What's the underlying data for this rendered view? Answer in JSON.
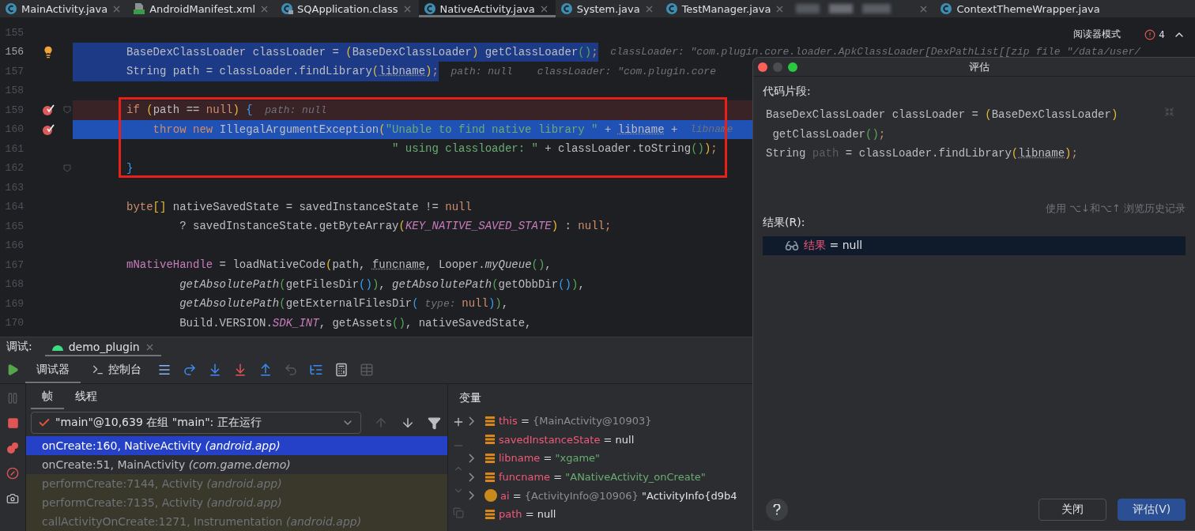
{
  "tabs": [
    {
      "label": "MainActivity.java",
      "kind": "class",
      "selected": false,
      "closable": true
    },
    {
      "label": "AndroidManifest.xml",
      "kind": "manifest",
      "selected": false,
      "closable": true
    },
    {
      "label": "SQApplication.class",
      "kind": "locked",
      "selected": false,
      "closable": true
    },
    {
      "label": "NativeActivity.java",
      "kind": "class",
      "selected": true,
      "closable": true
    },
    {
      "label": "System.java",
      "kind": "class",
      "selected": false,
      "closable": true
    },
    {
      "label": "TestManager.java",
      "kind": "class",
      "selected": false,
      "closable": true
    },
    {
      "kind": "blurred",
      "selected": false,
      "closable": true
    },
    {
      "label": "ContextThemeWrapper.java",
      "kind": "class",
      "selected": false,
      "closable": false
    }
  ],
  "reader_mode": "阅读器模式",
  "problems": {
    "count": "4"
  },
  "editor": {
    "lines": [
      {
        "number": "155"
      },
      {
        "number": "156",
        "intention": true,
        "selected": true,
        "tokens": [
          {
            "kind": "p",
            "text": "BaseDexClassLoader classLoader = "
          },
          {
            "kind": "y",
            "text": "("
          },
          {
            "kind": "p",
            "text": "BaseDexClassLoader"
          },
          {
            "kind": "y",
            "text": ")"
          },
          {
            "kind": "p",
            "text": " getClassLoader"
          },
          {
            "kind": "g",
            "text": "()"
          },
          {
            "kind": "k",
            "text": ";"
          },
          {
            "kind": "h",
            "text": "  classLoader: \"com.plugin.core.loader.ApkClassLoader[DexPathList[[zip file \"/data/user/"
          }
        ]
      },
      {
        "number": "157",
        "selected": true,
        "tokens": [
          {
            "kind": "p",
            "text": "String path = classLoader.findLibrary"
          },
          {
            "kind": "y",
            "text": "("
          },
          {
            "kind": "u",
            "text": "libname"
          },
          {
            "kind": "y",
            "text": ")"
          },
          {
            "kind": "k",
            "text": ";"
          },
          {
            "kind": "h",
            "text": "  path: null    classLoader: \"com.plugin.core"
          }
        ]
      },
      {
        "number": "158"
      },
      {
        "number": "159",
        "breakpoint": true,
        "fold": true,
        "boxed": true,
        "tokens": [
          {
            "kind": "k",
            "text": "if "
          },
          {
            "kind": "y",
            "text": "("
          },
          {
            "kind": "p",
            "text": "path == "
          },
          {
            "kind": "k",
            "text": "null"
          },
          {
            "kind": "y",
            "text": ")"
          },
          {
            "kind": "b",
            "text": " {"
          },
          {
            "kind": "h",
            "text": "  path: null"
          }
        ]
      },
      {
        "number": "160",
        "breakpoint": true,
        "current": true,
        "boxed": true,
        "tokens": [
          {
            "kind": "k",
            "text": "    throw new "
          },
          {
            "kind": "p",
            "text": "IllegalArgumentException"
          },
          {
            "kind": "y",
            "text": "("
          },
          {
            "kind": "s",
            "text": "\"Unable to find native library \""
          },
          {
            "kind": "p",
            "text": " + "
          },
          {
            "kind": "u",
            "text": "libname"
          },
          {
            "kind": "p",
            "text": " +"
          },
          {
            "kind": "h",
            "text": "  libname"
          }
        ]
      },
      {
        "number": "161",
        "boxed": true,
        "tokens": [
          {
            "kind": "s",
            "text": "                                        \" using classloader: \""
          },
          {
            "kind": "p",
            "text": " + classLoader.toString"
          },
          {
            "kind": "g",
            "text": "()"
          },
          {
            "kind": "y",
            "text": ")"
          },
          {
            "kind": "k",
            "text": ";"
          }
        ]
      },
      {
        "number": "162",
        "fold": true,
        "boxed": true,
        "tokens": [
          {
            "kind": "b",
            "text": "}"
          }
        ]
      },
      {
        "number": "163"
      },
      {
        "number": "164",
        "tokens": [
          {
            "kind": "k",
            "text": "byte"
          },
          {
            "kind": "y",
            "text": "[]"
          },
          {
            "kind": "p",
            "text": " nativeSavedState = savedInstanceState != "
          },
          {
            "kind": "k",
            "text": "null"
          }
        ]
      },
      {
        "number": "165",
        "tokens": [
          {
            "kind": "p",
            "text": "        ? savedInstanceState.getByteArray"
          },
          {
            "kind": "y",
            "text": "("
          },
          {
            "kind": "c",
            "text": "KEY_NATIVE_SAVED_STATE"
          },
          {
            "kind": "y",
            "text": ")"
          },
          {
            "kind": "p",
            "text": " : "
          },
          {
            "kind": "k",
            "text": "null;"
          }
        ]
      },
      {
        "number": "166"
      },
      {
        "number": "167",
        "tokens": [
          {
            "kind": "f",
            "text": "mNativeHandle"
          },
          {
            "kind": "p",
            "text": " = loadNativeCode"
          },
          {
            "kind": "y",
            "text": "("
          },
          {
            "kind": "p",
            "text": "path, "
          },
          {
            "kind": "u",
            "text": "funcname"
          },
          {
            "kind": "p",
            "text": ", Looper."
          },
          {
            "kind": "i",
            "text": "myQueue"
          },
          {
            "kind": "g",
            "text": "()"
          },
          {
            "kind": "p",
            "text": ","
          }
        ]
      },
      {
        "number": "168",
        "tokens": [
          {
            "kind": "i",
            "text": "        getAbsolutePath"
          },
          {
            "kind": "g",
            "text": "("
          },
          {
            "kind": "p",
            "text": "getFilesDir"
          },
          {
            "kind": "b",
            "text": "()"
          },
          {
            "kind": "g",
            "text": ")"
          },
          {
            "kind": "p",
            "text": ", "
          },
          {
            "kind": "i",
            "text": "getAbsolutePath"
          },
          {
            "kind": "g",
            "text": "("
          },
          {
            "kind": "p",
            "text": "getObbDir"
          },
          {
            "kind": "b",
            "text": "()"
          },
          {
            "kind": "g",
            "text": ")"
          },
          {
            "kind": "p",
            "text": ","
          }
        ]
      },
      {
        "number": "169",
        "tokens": [
          {
            "kind": "i",
            "text": "        getAbsolutePath"
          },
          {
            "kind": "g",
            "text": "("
          },
          {
            "kind": "p",
            "text": "getExternalFilesDir"
          },
          {
            "kind": "b",
            "text": "("
          },
          {
            "kind": "h",
            "text": " type: "
          },
          {
            "kind": "k",
            "text": "null"
          },
          {
            "kind": "b",
            "text": ")"
          },
          {
            "kind": "g",
            "text": ")"
          },
          {
            "kind": "p",
            "text": ","
          }
        ]
      },
      {
        "number": "170",
        "tokens": [
          {
            "kind": "p",
            "text": "        Build.VERSION."
          },
          {
            "kind": "c",
            "text": "SDK_INT"
          },
          {
            "kind": "p",
            "text": ", getAssets"
          },
          {
            "kind": "g",
            "text": "()"
          },
          {
            "kind": "p",
            "text": ", nativeSavedState,"
          }
        ]
      }
    ]
  },
  "dialog": {
    "title": "评估",
    "snippet_label": "代码片段:",
    "snippet": [
      {
        "tokens": [
          {
            "kind": "p",
            "text": "BaseDexClassLoader classLoader = "
          },
          {
            "kind": "y",
            "text": "("
          },
          {
            "kind": "p",
            "text": "BaseDexClassLoader"
          },
          {
            "kind": "y",
            "text": ")"
          }
        ]
      },
      {
        "tokens": [
          {
            "kind": "p",
            "text": " getClassLoader"
          },
          {
            "kind": "g",
            "text": "()"
          },
          {
            "kind": "k",
            "text": ";"
          }
        ]
      },
      {
        "tokens": [
          {
            "kind": "p",
            "text": "String "
          },
          {
            "kind": "d",
            "text": "path"
          },
          {
            "kind": "p",
            "text": " = classLoader.findLibrary"
          },
          {
            "kind": "y",
            "text": "("
          },
          {
            "kind": "u",
            "text": "libname"
          },
          {
            "kind": "y",
            "text": ")"
          },
          {
            "kind": "k",
            "text": ";"
          }
        ]
      }
    ],
    "history_hint": "使用 ⌥↓和⌥↑ 浏览历史记录",
    "result_label": "结果(R):",
    "result": {
      "name": "结果",
      "operator": "=",
      "value": "null"
    },
    "buttons": [
      {
        "label": "关闭",
        "primary": false
      },
      {
        "label": "评估(V)",
        "primary": true
      }
    ]
  },
  "debug": {
    "label": "调试:",
    "session_tab": "demo_plugin",
    "tabs": [
      {
        "label": "调试器",
        "selected": true
      },
      {
        "label": "控制台",
        "selected": false
      }
    ],
    "frame_tabs": [
      {
        "label": "帧",
        "selected": true
      },
      {
        "label": "线程",
        "selected": false
      }
    ],
    "thread": "\"main\"@10,639 在组 \"main\": 正在运行",
    "frames": [
      {
        "text": "onCreate:160, NativeActivity *(android.app)*",
        "kind": "user",
        "selected": true
      },
      {
        "text": "onCreate:51, MainActivity *(com.game.demo)*",
        "kind": "user",
        "selected": false
      },
      {
        "text": "performCreate:7144, Activity *(android.app)*",
        "kind": "library",
        "selected": false
      },
      {
        "text": "performCreate:7135, Activity *(android.app)*",
        "kind": "library",
        "selected": false
      },
      {
        "text": "callActivityOnCreate:1271, Instrumentation *(android.app)*",
        "kind": "library",
        "selected": false
      }
    ],
    "variables_title": "变量",
    "variables": [
      {
        "kind": "field",
        "expandable": true,
        "name": "this",
        "operator": "=",
        "value": {
          "kind": "ref",
          "text": "{MainActivity@10903}"
        }
      },
      {
        "kind": "field",
        "expandable": false,
        "name": "savedInstanceState",
        "operator": "=",
        "value": {
          "kind": "null",
          "text": "null"
        }
      },
      {
        "kind": "field",
        "expandable": true,
        "name": "libname",
        "operator": "=",
        "value": {
          "kind": "string",
          "text": "\"xgame\""
        }
      },
      {
        "kind": "field",
        "expandable": true,
        "name": "funcname",
        "operator": "=",
        "value": {
          "kind": "string",
          "text": "\"ANativeActivity_onCreate\""
        }
      },
      {
        "kind": "param",
        "expandable": true,
        "name": "ai",
        "operator": "=",
        "value": {
          "kind": "ref",
          "text": "{ActivityInfo@10906}"
        },
        "detail": "\"ActivityInfo{d9b4"
      },
      {
        "kind": "field",
        "expandable": false,
        "name": "path",
        "operator": "=",
        "value": {
          "kind": "null",
          "text": "null"
        }
      }
    ]
  }
}
